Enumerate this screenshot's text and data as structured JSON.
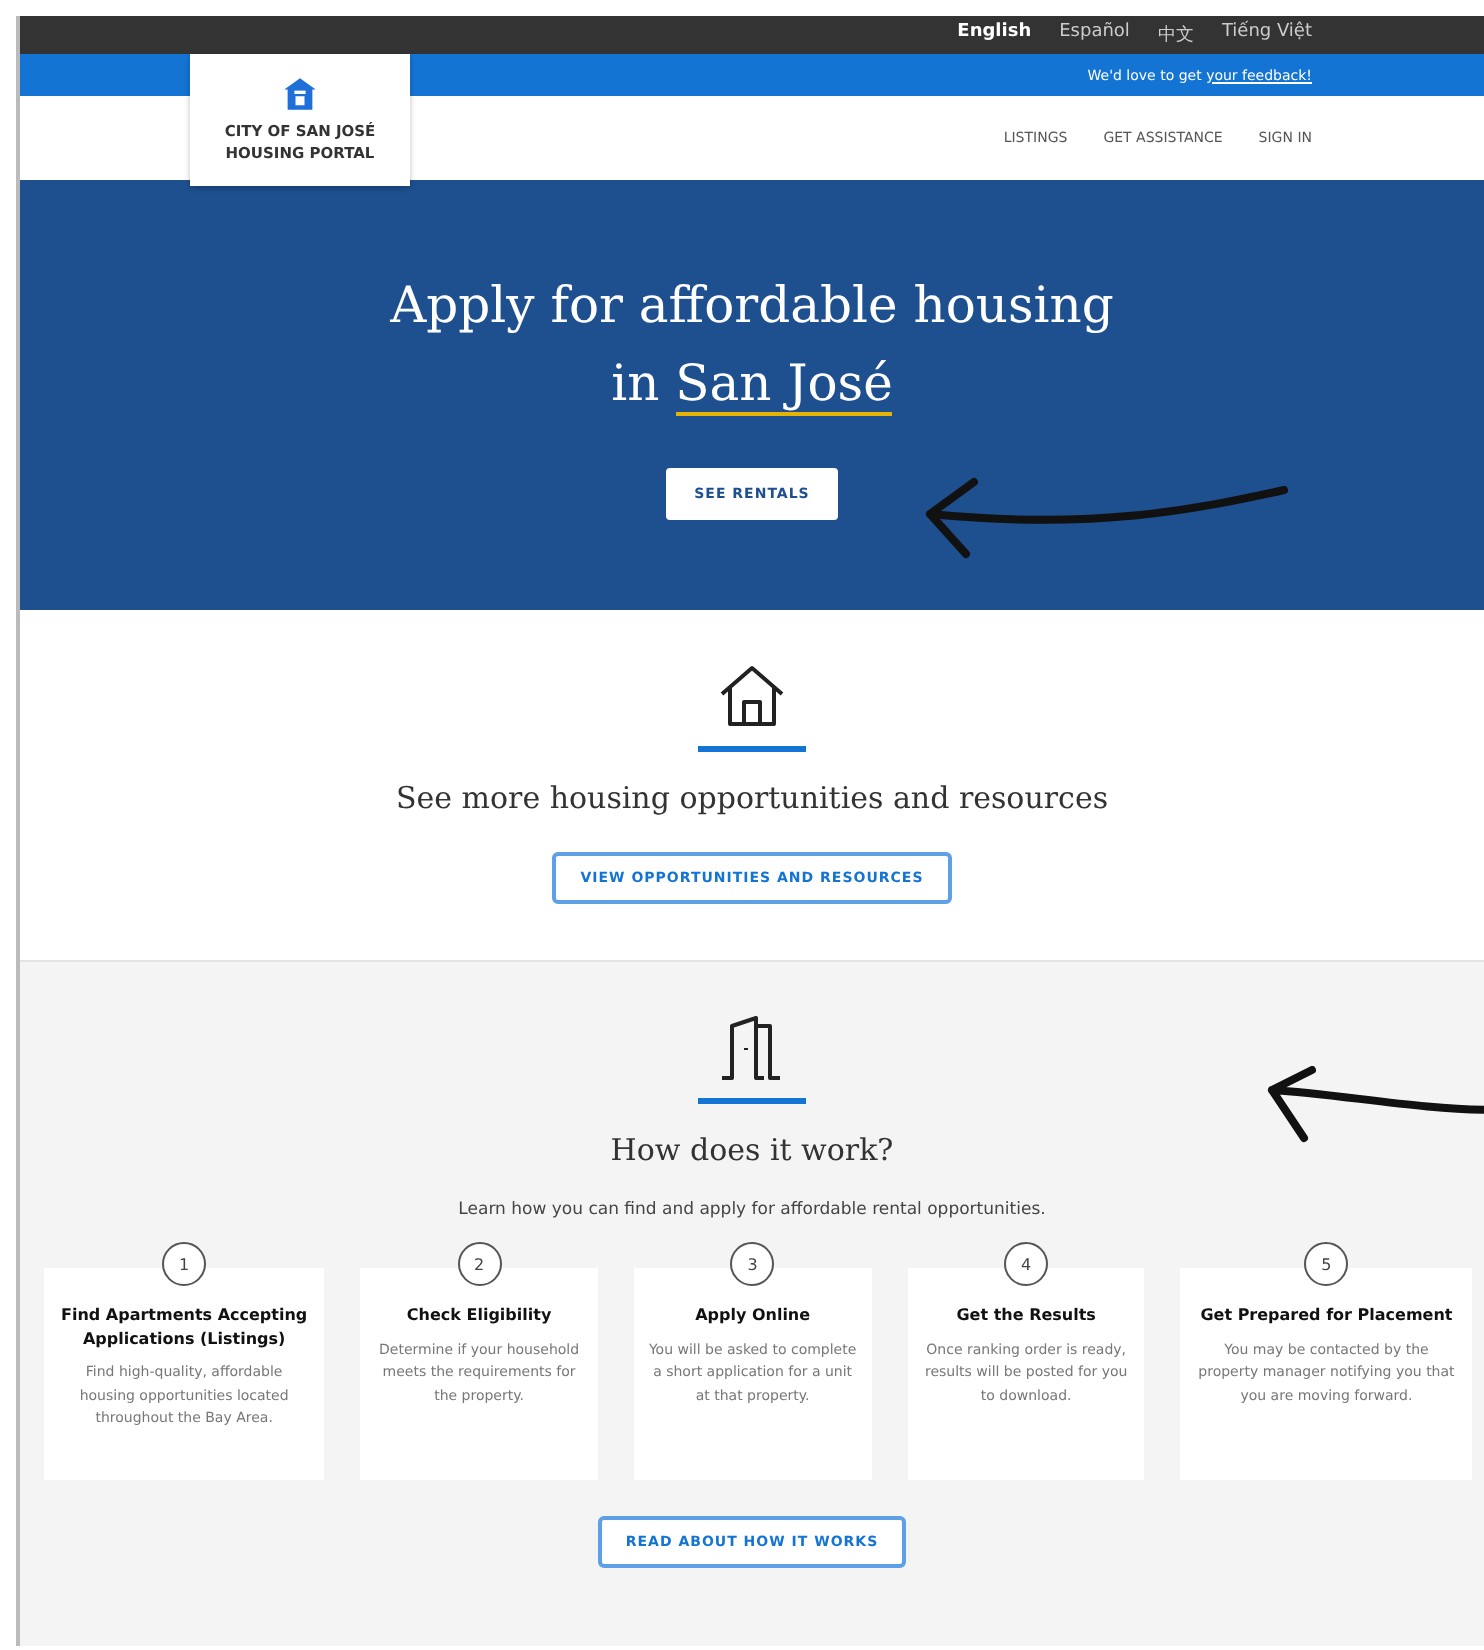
{
  "languages": [
    {
      "label": "English",
      "selected": true
    },
    {
      "label": "Español",
      "selected": false
    },
    {
      "label": "中文",
      "selected": false
    },
    {
      "label": "Tiếng Việt",
      "selected": false
    }
  ],
  "feedback_bar": {
    "text": "We'd love to get",
    "link": "your feedback!"
  },
  "logo": {
    "line_1": "CITY OF SAN JOSÉ",
    "line_2": "HOUSING PORTAL"
  },
  "nav": [
    "LISTINGS",
    "GET ASSISTANCE",
    "SIGN IN"
  ],
  "hero": {
    "title_line_1": "Apply for affordable housing",
    "title_prefix": "in",
    "title_highlight": "San José",
    "button": "SEE RENTALS"
  },
  "resources": {
    "heading": "See more housing opportunities and resources",
    "button": "VIEW OPPORTUNITIES AND RESOURCES"
  },
  "how_it_works": {
    "heading": "How does it work?",
    "subtitle": "Learn how you can find and apply for affordable rental opportunities.",
    "button": "READ ABOUT HOW IT WORKS",
    "steps": [
      {
        "number": "1",
        "title": "Find Apartments Accepting Applications (Listings)",
        "text": "Find high-quality, affordable housing opportunities located throughout the Bay Area."
      },
      {
        "number": "2",
        "title": "Check Eligibility",
        "text": "Determine if your household meets the requirements for the property."
      },
      {
        "number": "3",
        "title": "Apply Online",
        "text": "You will be asked to complete a short application for a unit at that property."
      },
      {
        "number": "4",
        "title": "Get the Results",
        "text": "Once ranking order is ready, results will be posted for you to download."
      },
      {
        "number": "5",
        "title": "Get Prepared for Placement",
        "text": "You may be contacted by the property manager notifying you that you are moving forward."
      }
    ]
  }
}
